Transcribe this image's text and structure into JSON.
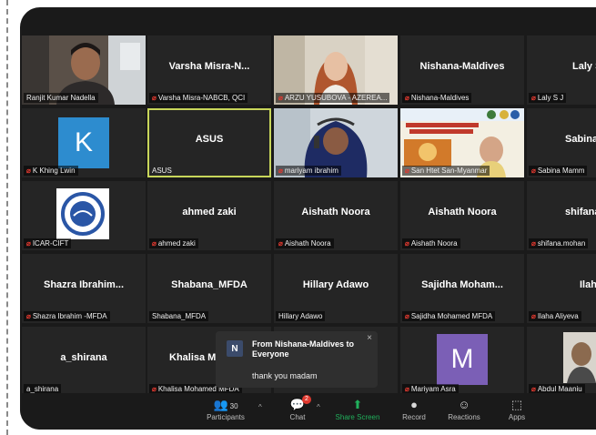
{
  "tiles": [
    {
      "center": "",
      "label": "Ranjit Kumar Nadella",
      "muted": false
    },
    {
      "center": "Varsha Misra-N...",
      "label": "Varsha Misra-NABCB, QCI",
      "muted": true
    },
    {
      "center": "",
      "label": "ARZU YUSUBOVA - AZEREA...",
      "muted": true
    },
    {
      "center": "Nishana-Maldives",
      "label": "Nishana-Maldives",
      "muted": true
    },
    {
      "center": "Laly S",
      "label": "Laly S J",
      "muted": true
    },
    {
      "center": "",
      "letter": "K",
      "label": "K Khing Lwin",
      "muted": true
    },
    {
      "center": "ASUS",
      "label": "ASUS",
      "muted": false
    },
    {
      "center": "",
      "label": "mariyam ibrahim",
      "muted": true
    },
    {
      "center": "",
      "label": "San Htet San-Myanmar",
      "muted": true
    },
    {
      "center": "Sabina Ma",
      "label": "Sabina Mamm",
      "muted": true
    },
    {
      "center": "",
      "label": "ICAR-CIFT",
      "muted": true
    },
    {
      "center": "ahmed zaki",
      "label": "ahmed zaki",
      "muted": true
    },
    {
      "center": "Aishath Noora",
      "label": "Aishath Noora",
      "muted": true
    },
    {
      "center": "Aishath Noora",
      "label": "Aishath Noora",
      "muted": true
    },
    {
      "center": "shifana.mo",
      "label": "shifana.mohan",
      "muted": true
    },
    {
      "center": "Shazra  Ibrahim...",
      "label": "Shazra Ibrahim -MFDA",
      "muted": true
    },
    {
      "center": "Shabana_MFDA",
      "label": "Shabana_MFDA",
      "muted": false
    },
    {
      "center": "Hillary Adawo",
      "label": "Hillary Adawo",
      "muted": false
    },
    {
      "center": "Sajidha  Moham...",
      "label": "Sajidha Mohamed MFDA",
      "muted": true
    },
    {
      "center": "Ilaha Al",
      "label": "Ilaha Aliyeva",
      "muted": true
    },
    {
      "center": "a_shirana",
      "label": "a_shirana",
      "muted": false
    },
    {
      "center": "Khalisa  M",
      "label": "Khalisa Mohamed MFDA",
      "muted": true
    },
    {
      "center": "",
      "label": "",
      "muted": false
    },
    {
      "center": "",
      "letter": "M",
      "label": "Mariyam Asra",
      "muted": true
    },
    {
      "center": "",
      "label": "Abdul Maaniu",
      "muted": true
    }
  ],
  "colors": {
    "window_bg": "#1a1a1a",
    "tile_bg": "#252525",
    "active_speaker_border": "#c8d65a",
    "share_green": "#21b05c",
    "avatar_k": "#2d8ccf",
    "avatar_m": "#7b5fb6",
    "muted_red": "#e0392f"
  },
  "chat_popup": {
    "icon_letter": "N",
    "from": "From Nishana-Maldives to Everyone",
    "message": "thank you madam",
    "close": "×"
  },
  "toolbar": {
    "participants_count": "30",
    "participants_label": "Participants",
    "chat_badge": "2",
    "chat_label": "Chat",
    "share_label": "Share Screen",
    "record_label": "Record",
    "reactions_label": "Reactions",
    "apps_label": "Apps"
  }
}
